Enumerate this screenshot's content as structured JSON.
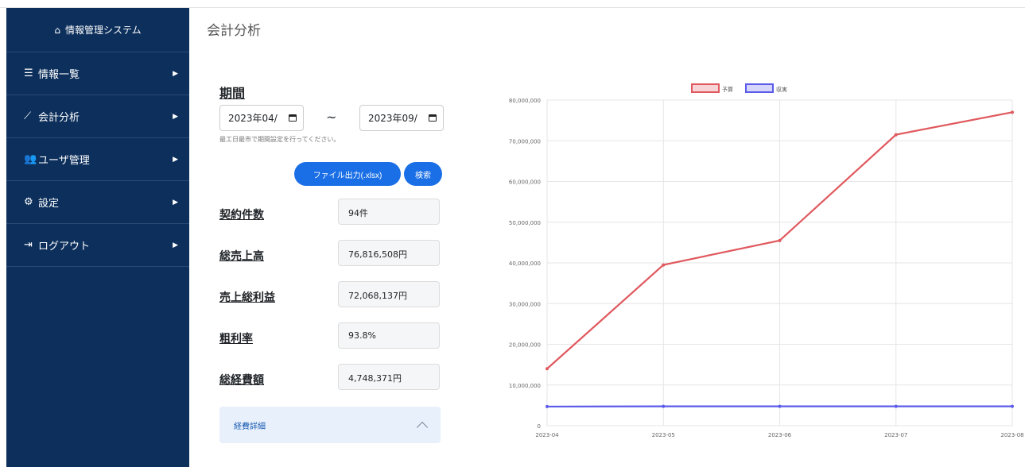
{
  "sidebar": {
    "brand": "情報管理システム",
    "items": [
      {
        "icon": "list-icon",
        "glyph": "☰",
        "label": "情報一覧"
      },
      {
        "icon": "chart-line-icon",
        "glyph": "⟋",
        "label": "会計分析"
      },
      {
        "icon": "users-icon",
        "glyph": "👥",
        "label": "ユーザ管理"
      },
      {
        "icon": "gear-icon",
        "glyph": "⚙",
        "label": "設定"
      },
      {
        "icon": "logout-icon",
        "glyph": "⇥",
        "label": "ログアウト"
      }
    ]
  },
  "main": {
    "title": "会計分析",
    "period_label": "期間",
    "date_from": "2023年04/",
    "tilde": "~",
    "date_to": "2023年09/",
    "hint": "最工日最市で期間設定を行ってください。",
    "export_button": "ファイル出力(.xlsx)",
    "search_button": "検索",
    "metrics": [
      {
        "label": "契約件数",
        "value": "94件"
      },
      {
        "label": "総売上高",
        "value": "76,816,508円"
      },
      {
        "label": "売上総利益",
        "value": "72,068,137円"
      },
      {
        "label": "粗利率",
        "value": "93.8%"
      },
      {
        "label": "総経費額",
        "value": "4,748,371円"
      }
    ],
    "accordion_label": "経費詳細"
  },
  "chart_data": {
    "type": "line",
    "x": [
      "2023-04",
      "2023-05",
      "2023-06",
      "2023-07",
      "2023-08"
    ],
    "yticks": [
      "0",
      "10,000,000",
      "20,000,000",
      "30,000,000",
      "40,000,000",
      "50,000,000",
      "60,000,000",
      "70,000,000",
      "80,000,000"
    ],
    "ylim": [
      0,
      80000000
    ],
    "series": [
      {
        "name": "予算",
        "color": "#e0595e",
        "values": [
          14000000,
          39500000,
          45500000,
          71500000,
          77000000
        ]
      },
      {
        "name": "収実",
        "color": "#5b5bea",
        "values": [
          4700000,
          4750000,
          4750000,
          4750000,
          4750000
        ]
      }
    ],
    "legend": "top-center",
    "grid": true
  }
}
